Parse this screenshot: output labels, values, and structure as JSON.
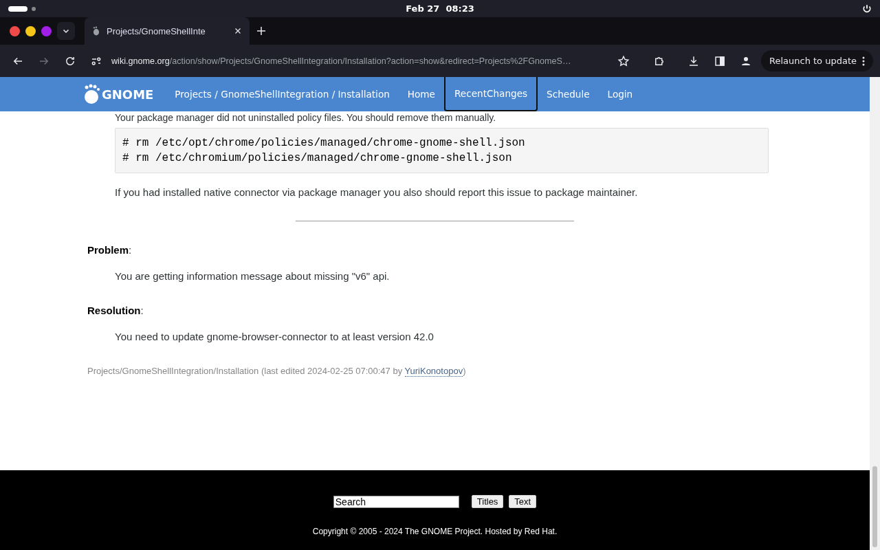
{
  "top_bar": {
    "clock": "Feb 27  08:23"
  },
  "browser": {
    "tab": {
      "title": "Projects/GnomeShellInte",
      "selected": true
    },
    "url": {
      "host": "wiki.gnome.org",
      "path": "/action/show/Projects/GnomeShellIntegration/Installation?action=show&redirect=Projects%2FGnomeS…"
    },
    "update_button": "Relaunch to update"
  },
  "site_header": {
    "logo": "GNOME",
    "nav": [
      {
        "label": "Projects / GnomeShellIntegration / Installation",
        "selected": false
      },
      {
        "label": "Home",
        "selected": false
      },
      {
        "label": "RecentChanges",
        "selected": true
      },
      {
        "label": "Schedule",
        "selected": false
      },
      {
        "label": "Login",
        "selected": false
      }
    ]
  },
  "content": {
    "cut_paragraph": "Your package manager did not uninstalled policy files. You should remove them manually.",
    "code_lines": [
      "# rm /etc/opt/chrome/policies/managed/chrome-gnome-shell.json",
      "# rm /etc/chromium/policies/managed/chrome-gnome-shell.json"
    ],
    "note": "If you had installed native connector via package manager you also should report this issue to package maintainer.",
    "items": [
      {
        "label": "**Problem**:",
        "text": "You are getting information message about missing \"v6\" api."
      },
      {
        "label": "**Resolution**:",
        "text": "You need to update gnome-browser-connector to at least version 42.0"
      }
    ],
    "page_info": "Projects/GnomeShellIntegration/Installation (last edited 2024-02-25 07:00:47 by ",
    "author": "YuriKonotopov",
    "page_info_end": ")"
  },
  "footer": {
    "search": {
      "value": "Search"
    },
    "buttons": [
      "Titles",
      "Text"
    ],
    "copyright": "Copyright © 2005 - 2024 The GNOME Project. Hosted by Red Hat."
  }
}
